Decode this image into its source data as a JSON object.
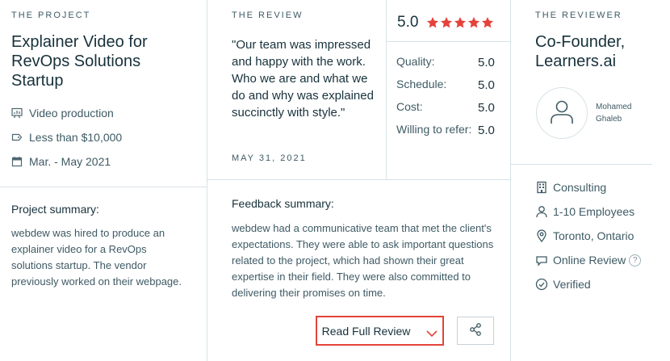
{
  "project": {
    "eyebrow": "THE PROJECT",
    "title": "Explainer Video for RevOps Solutions Startup",
    "service": "Video production",
    "budget": "Less than $10,000",
    "dates": "Mar. - May 2021",
    "summary_heading": "Project summary:",
    "summary_text": "webdew was hired to produce an explainer video for a RevOps solutions startup. The vendor previously worked on their webpage."
  },
  "review": {
    "eyebrow": "THE REVIEW",
    "quote": "\"Our team was impressed and happy with the work. Who we are and what we do and why was explained succinctly with style.\"",
    "date": "MAY 31, 2021",
    "overall_rating": "5.0",
    "star_count": 5,
    "ratings": [
      {
        "label": "Quality:",
        "value": "5.0"
      },
      {
        "label": "Schedule:",
        "value": "5.0"
      },
      {
        "label": "Cost:",
        "value": "5.0"
      },
      {
        "label": "Willing to refer:",
        "value": "5.0"
      }
    ],
    "feedback_heading": "Feedback summary:",
    "feedback_text": "webdew had a communicative team that met the client's expectations. They were able to ask important questions related to the project, which had shown their great expertise in their field. They were also committed to delivering their promises on time.",
    "read_full_label": "Read Full Review"
  },
  "reviewer": {
    "eyebrow": "THE REVIEWER",
    "title": "Co-Founder, Learners.ai",
    "first_name": "Mohamed",
    "last_name": "Ghaleb",
    "industry": "Consulting",
    "employees": "1-10 Employees",
    "location": "Toronto, Ontario",
    "review_type": "Online Review",
    "help_glyph": "?",
    "verified": "Verified"
  },
  "colors": {
    "star": "#e4433b",
    "accent_border": "#e4433b",
    "text_dark": "#17313b",
    "text_muted": "#3e5a64",
    "divider": "#d7e2e6"
  }
}
